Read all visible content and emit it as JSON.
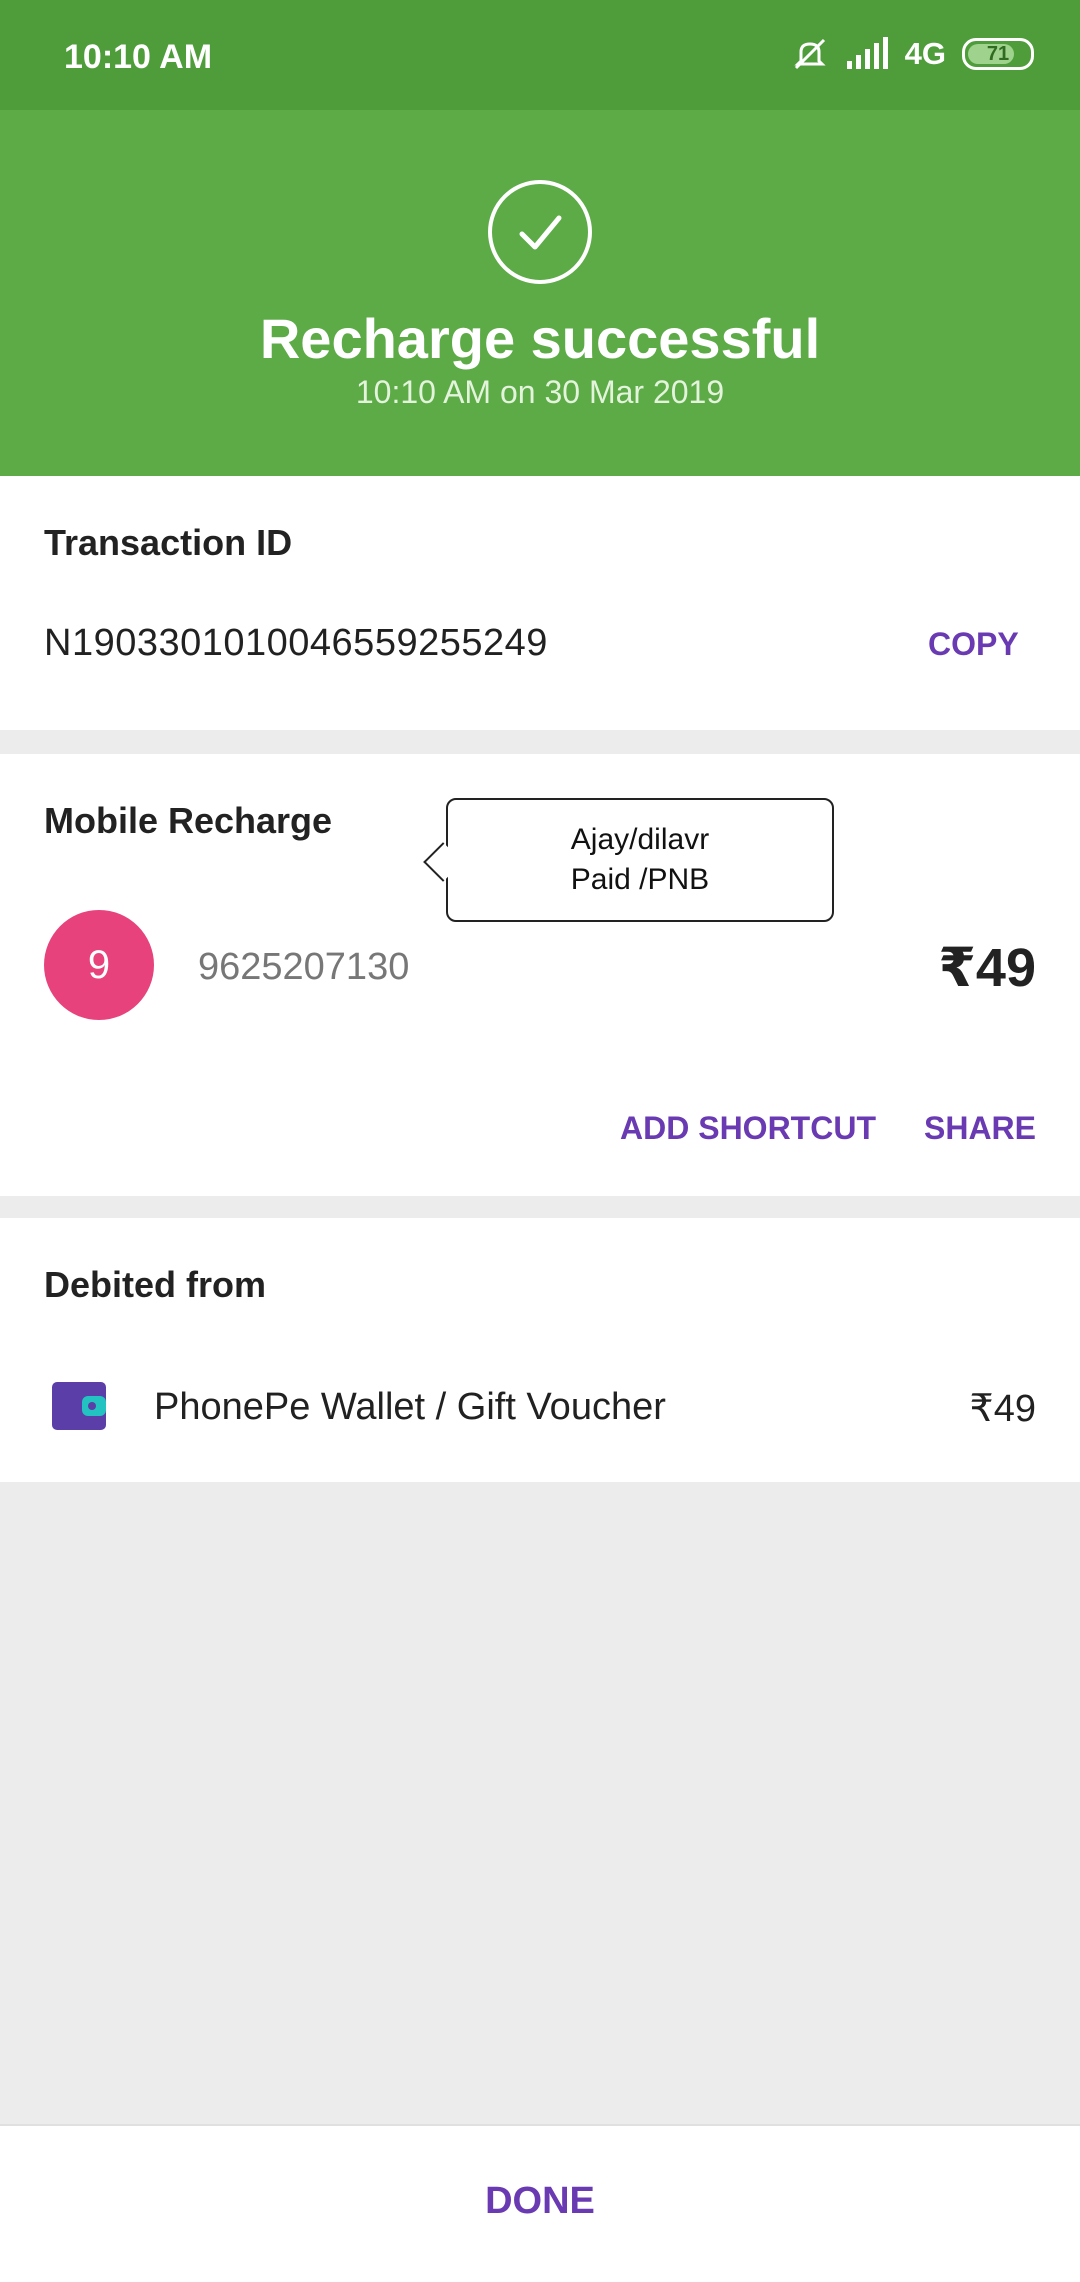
{
  "status_bar": {
    "time": "10:10 AM",
    "network": "4G",
    "battery": "71"
  },
  "header": {
    "title": "Recharge successful",
    "subtitle": "10:10 AM on 30 Mar 2019",
    "icon": "check-circle-icon",
    "color": "#5dab47"
  },
  "transaction": {
    "label": "Transaction ID",
    "id": "N1903301010046559255249",
    "copy_label": "COPY"
  },
  "recharge": {
    "label": "Mobile Recharge",
    "avatar_letter": "9",
    "phone": "9625207130",
    "amount": "₹49",
    "add_shortcut_label": "ADD SHORTCUT",
    "share_label": "SHARE",
    "annotation_line1": "Ajay/dilavr",
    "annotation_line2": "Paid /PNB"
  },
  "debit": {
    "label": "Debited from",
    "source": "PhonePe Wallet / Gift Voucher",
    "amount": "₹49",
    "icon": "wallet-icon"
  },
  "footer": {
    "done_label": "DONE"
  },
  "colors": {
    "accent": "#6a3ab2",
    "success": "#5dab47",
    "avatar": "#e8427c"
  }
}
